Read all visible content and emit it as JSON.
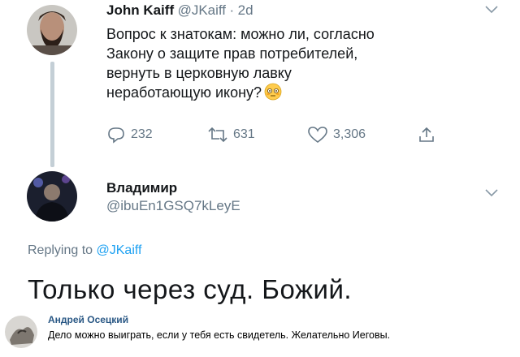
{
  "tweet": {
    "author_name": "John Kaiff",
    "author_handle": "@JKaiff",
    "separator": "·",
    "time": "2d",
    "text_lines": [
      "Вопрос к знатокам: можно ли, согласно",
      "Закону о защите прав потребителей,",
      "вернуть в церковную лавку",
      "неработающую икону?"
    ],
    "emoji": "flushed-face",
    "reply_count": "232",
    "retweet_count": "631",
    "like_count": "3,306"
  },
  "reply": {
    "author_name": "Владимир",
    "author_handle": "@ibuEn1GSQ7kLeyE",
    "replying_prefix": "Replying to",
    "replying_mention": "@JKaiff",
    "text": "Только через суд. Божий."
  },
  "comment": {
    "author_name": "Андрей Осецкий",
    "text": "Дело можно выиграть, если у тебя есть свидетель. Желательно Иеговы."
  },
  "icons": {
    "reply": "reply-icon",
    "retweet": "retweet-icon",
    "like": "heart-icon",
    "share": "share-icon",
    "menu": "chevron-down-icon"
  },
  "colors": {
    "text": "#14171a",
    "muted": "#657786",
    "link": "#1da1f2",
    "thread_line": "#c4cfd6",
    "comment_name": "#2a5885"
  }
}
